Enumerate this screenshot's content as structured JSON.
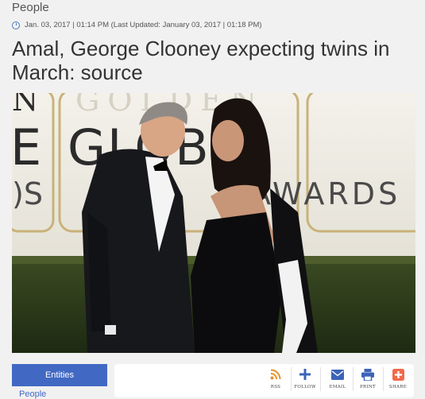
{
  "article": {
    "category": "People",
    "dateline": "Jan. 03, 2017 | 01:14 PM (Last Updated: January 03, 2017 | 01:18 PM)",
    "headline": "Amal, George Clooney expecting twins in March: source"
  },
  "photo": {
    "backdrop_letters": [
      "GOLDEN",
      "GLOBE",
      "AWARDS"
    ]
  },
  "entities": {
    "button_label": "Entities",
    "first_item": "People"
  },
  "share": {
    "items": [
      {
        "label": "RSS",
        "icon": "rss-icon",
        "color": "#e6932b"
      },
      {
        "label": "FOLLOW",
        "icon": "plus-icon",
        "color": "#3c63b8"
      },
      {
        "label": "EMAIL",
        "icon": "envelope-icon",
        "color": "#3c63b8"
      },
      {
        "label": "PRINT",
        "icon": "printer-icon",
        "color": "#3c63b8"
      },
      {
        "label": "SHARE",
        "icon": "share-plus-icon",
        "color": "#f26a4b"
      }
    ]
  },
  "colors": {
    "accent": "#4169c4",
    "clock_icon": "#4a78c2"
  }
}
